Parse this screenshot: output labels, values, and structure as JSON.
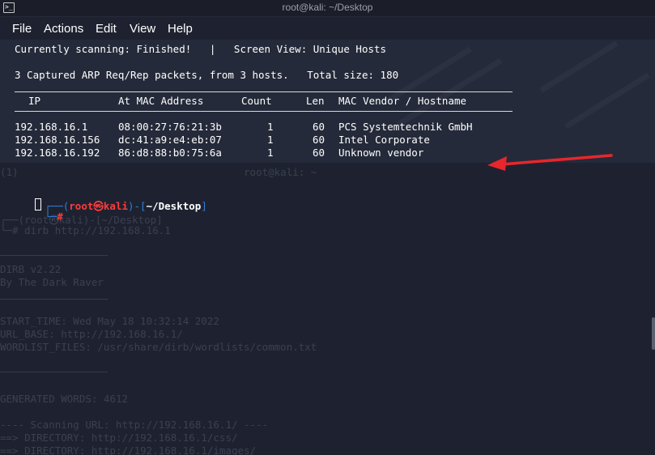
{
  "window": {
    "title": "root@kali: ~/Desktop",
    "icon": "terminal-icon"
  },
  "menu": [
    {
      "label": "File"
    },
    {
      "label": "Actions"
    },
    {
      "label": "Edit"
    },
    {
      "label": "View"
    },
    {
      "label": "Help"
    }
  ],
  "terminal": {
    "status_line": "Currently scanning: Finished!   |   Screen View: Unique Hosts",
    "summary_line": "3 Captured ARP Req/Rep packets, from 3 hosts.   Total size: 180",
    "table": {
      "headers": [
        "IP",
        "At MAC Address",
        "Count",
        "Len",
        "MAC Vendor / Hostname"
      ],
      "rows": [
        [
          "192.168.16.1",
          "08:00:27:76:21:3b",
          "1",
          "60",
          "PCS Systemtechnik GmbH"
        ],
        [
          "192.168.16.156",
          "dc:41:a9:e4:eb:07",
          "1",
          "60",
          "Intel Corporate"
        ],
        [
          "192.168.16.192",
          "86:d8:88:b0:75:6a",
          "1",
          "60",
          "Unknown vendor"
        ]
      ]
    },
    "prompt": {
      "open": "┌──(",
      "user": "root",
      "at": "㉿",
      "host": "kali",
      "mid": ")-[",
      "path": "~/Desktop",
      "close": "]",
      "second_prefix": "└─",
      "symbol": "#"
    },
    "ghost_lines": [
      "(1)                                     root@kali: ~",
      "┌──(root㉿kali)-[~/Desktop]",
      "└─# dirb http://192.168.16.1",
      "DIRB v2.22",
      "By The Dark Raver",
      "START_TIME: Wed May 18 10:32:14 2022",
      "URL_BASE: http://192.168.16.1/",
      "WORDLIST_FILES: /usr/share/dirb/wordlists/common.txt",
      "GENERATED WORDS: 4612",
      "---- Scanning URL: http://192.168.16.1/ ----",
      "==> DIRECTORY: http://192.168.16.1/css/",
      "==> DIRECTORY: http://192.168.16.1/images/"
    ]
  },
  "colors": {
    "background": "#1e2230",
    "prompt_blue": "#2f7fd8",
    "prompt_red": "#ff3b3b",
    "arrow_red": "#e8262b"
  }
}
